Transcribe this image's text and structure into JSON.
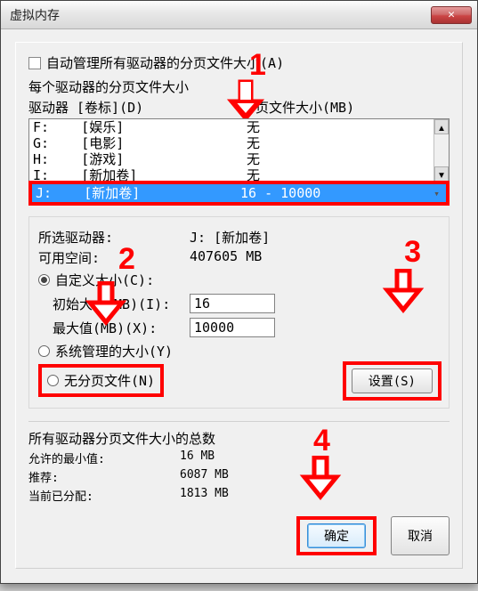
{
  "window": {
    "title": "虚拟内存"
  },
  "auto_manage": {
    "label": "自动管理所有驱动器的分页文件大小(A)",
    "checked": false
  },
  "section_header": "每个驱动器的分页文件大小",
  "columns": {
    "drive": "驱动器  [卷标](D)",
    "paging": "分页文件大小(MB)"
  },
  "drives": [
    {
      "letter": "F:",
      "label": "[娱乐]",
      "size": "无"
    },
    {
      "letter": "G:",
      "label": "[电影]",
      "size": "无"
    },
    {
      "letter": "H:",
      "label": "[游戏]",
      "size": "无"
    },
    {
      "letter": "I:",
      "label": "[新加卷]",
      "size": "无"
    }
  ],
  "selected_drive": {
    "letter": "J:",
    "label": "[新加卷]",
    "size": "16 - 10000"
  },
  "selected_info": {
    "drive_label": "所选驱动器:",
    "drive_value": "J:  [新加卷]",
    "space_label": "可用空间:",
    "space_value": "407605 MB"
  },
  "custom_size": {
    "radio_label": "自定义大小(C):",
    "initial_label": "初始大小(MB)(I):",
    "initial_value": "16",
    "max_label": "最大值(MB)(X):",
    "max_value": "10000",
    "selected": true
  },
  "system_managed": {
    "label": "系统管理的大小(Y)",
    "selected": false
  },
  "no_paging": {
    "label": "无分页文件(N)",
    "selected": false
  },
  "set_button": "设置(S)",
  "totals": {
    "header": "所有驱动器分页文件大小的总数",
    "min_label": "允许的最小值:",
    "min_value": "16 MB",
    "rec_label": "推荐:",
    "rec_value": "6087 MB",
    "cur_label": "当前已分配:",
    "cur_value": "1813 MB"
  },
  "buttons": {
    "ok": "确定",
    "cancel": "取消"
  },
  "annotations": {
    "n1": "1",
    "n2": "2",
    "n3": "3",
    "n4": "4"
  },
  "colors": {
    "accent_red": "#ff0000",
    "selection_blue": "#3399ff"
  }
}
